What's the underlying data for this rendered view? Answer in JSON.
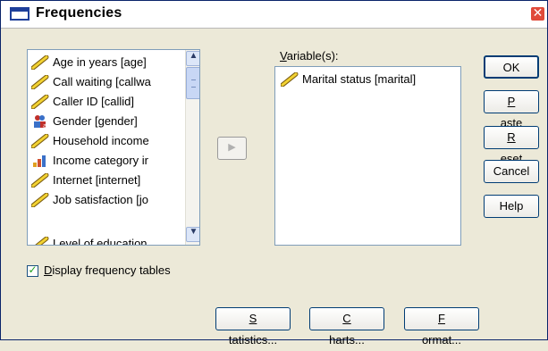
{
  "window": {
    "title": "Frequencies",
    "close_glyph": "✕"
  },
  "variables_list": {
    "items": [
      {
        "label": "Age in years [age]",
        "icon": "ruler-icon"
      },
      {
        "label": "Call waiting [callwa",
        "icon": "ruler-icon"
      },
      {
        "label": "Caller ID [callid]",
        "icon": "ruler-icon"
      },
      {
        "label": "Gender [gender]",
        "icon": "nominal-icon"
      },
      {
        "label": "Household income",
        "icon": "ruler-icon"
      },
      {
        "label": "Income category ir",
        "icon": "ordinal-icon"
      },
      {
        "label": "Internet [internet]",
        "icon": "ruler-icon"
      },
      {
        "label": "Job satisfaction [jo",
        "icon": "ruler-icon"
      },
      {
        "label": "Level of education",
        "icon": "ruler-icon"
      }
    ],
    "scroll_up_glyph": "▲",
    "scroll_down_glyph": "▼"
  },
  "move_button_glyph": "▶",
  "selected": {
    "label_mnemonic": "V",
    "label_rest": "ariable(s):",
    "items": [
      {
        "label": "Marital status [marital]",
        "icon": "ruler-icon"
      }
    ]
  },
  "buttons": {
    "ok": "OK",
    "paste": {
      "mnemonic": "P",
      "rest": "aste"
    },
    "reset": {
      "mnemonic": "R",
      "rest": "eset"
    },
    "cancel": "Cancel",
    "help": "Help",
    "statistics": {
      "mnemonic": "S",
      "rest": "tatistics..."
    },
    "charts": {
      "mnemonic": "C",
      "rest": "harts..."
    },
    "format": {
      "mnemonic": "F",
      "rest": "ormat..."
    }
  },
  "display_checkbox": {
    "checked": true,
    "check_glyph": "✓",
    "mnemonic": "D",
    "rest": "isplay frequency tables"
  },
  "colors": {
    "title_border": "#0a246a",
    "dialog_bg": "#ece9d8",
    "button_border": "#003c74",
    "listbox_border": "#7f9db9"
  }
}
